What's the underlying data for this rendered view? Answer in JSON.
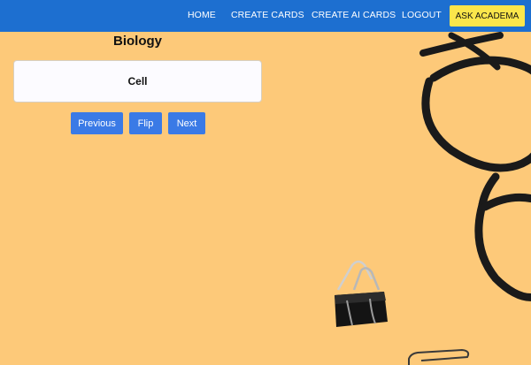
{
  "nav": {
    "home": "HOME",
    "create_cards": "CREATE CARDS",
    "create_ai_cards": "CREATE AI CARDS",
    "logout": "LOGOUT",
    "ask_academa": "ASK ACADEMA"
  },
  "deck": {
    "title": "Biology",
    "card_text": "Cell"
  },
  "controls": {
    "previous": "Previous",
    "flip": "Flip",
    "next": "Next"
  },
  "colors": {
    "navbar": "#1d6fd0",
    "ask_button": "#fbe64b",
    "action_button": "#3a7ae6",
    "background": "#fdc979"
  }
}
